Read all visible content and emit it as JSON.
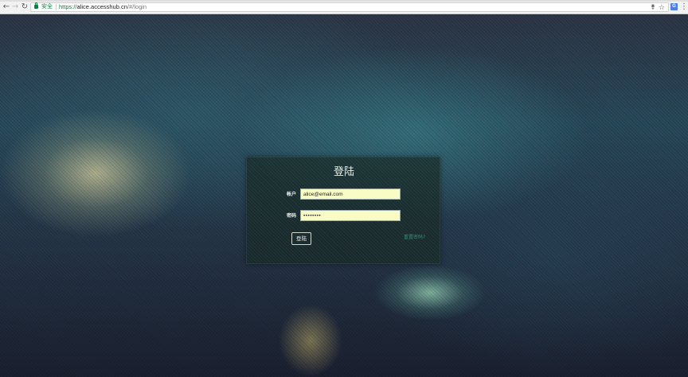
{
  "browser": {
    "secure_label": "安全",
    "url_protocol": "https://",
    "url_host": "alice.accesshub.cn",
    "url_path": "/#/login",
    "icons": [
      "back-icon",
      "forward-icon",
      "reload-icon",
      "lock-icon",
      "key-icon",
      "star-icon",
      "translate-icon",
      "menu-icon"
    ]
  },
  "login": {
    "title": "登陆",
    "account_label": "帐户",
    "account_value": "alice@email.com",
    "password_label": "密码",
    "password_value": "••••••••",
    "submit_label": "登陆",
    "forgot_label": "重置密码?"
  },
  "colors": {
    "input_background": "#fafcc6",
    "link": "#2f8a7a",
    "secure_green": "#0b8043"
  }
}
